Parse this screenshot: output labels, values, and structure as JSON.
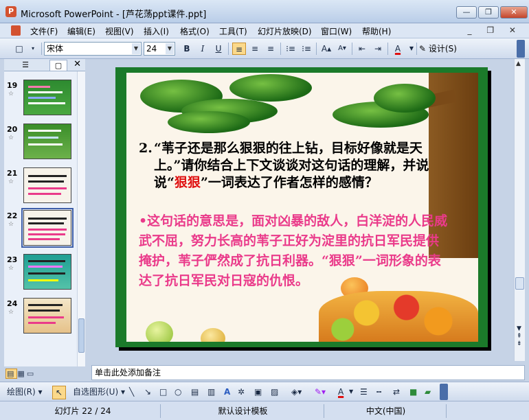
{
  "window": {
    "title": "Microsoft PowerPoint - [芦花荡ppt课件.ppt]",
    "minimize": "—",
    "maximize": "❐",
    "close": "✕"
  },
  "menu": [
    "文件(F)",
    "编辑(E)",
    "视图(V)",
    "插入(I)",
    "格式(O)",
    "工具(T)",
    "幻灯片放映(D)",
    "窗口(W)",
    "帮助(H)"
  ],
  "mdi_controls": "_ ❐ ✕",
  "toolbar": {
    "font_name": "宋体",
    "font_size": "24",
    "bold": "B",
    "italic": "I",
    "underline": "U",
    "design_label": "设计(S)"
  },
  "slides_pane": {
    "outline_tab_icon": "outline-icon",
    "slides_tab_icon": "slides-icon",
    "close": "✕",
    "slides": [
      {
        "number": "19"
      },
      {
        "number": "20"
      },
      {
        "number": "21"
      },
      {
        "number": "22",
        "selected": true
      },
      {
        "number": "23"
      },
      {
        "number": "24"
      }
    ]
  },
  "slide": {
    "question_number": "2.",
    "question_part1": "“苇子还是那么狠狠的往上钻，目标好像就是天上。”请你结合上下文谈谈对这句话的理解，并说说“",
    "question_highlight": "狠狠",
    "question_part2": "”一词表达了作者怎样的感情？",
    "answer": "•这句话的意思是，面对凶暴的敌人，白洋淀的人民威武不屈，努力长高的苇子正好为淀里的抗日军民提供掩护，苇子俨然成了抗日利器。“狠狠”一词形象的表达了抗日军民对日寇的仇恨。"
  },
  "notes_placeholder": "单击此处添加备注",
  "drawing_toolbar": {
    "draw_label": "绘图(R)",
    "autoshapes_label": "自选图形(U)"
  },
  "status": {
    "slide_info": "幻灯片 22 / 24",
    "template": "默认设计模板",
    "language": "中文(中国)"
  },
  "colors": {
    "slide_border": "#1b7a2a",
    "highlight_red": "#e01010",
    "answer_pink": "#ea3a8a"
  }
}
